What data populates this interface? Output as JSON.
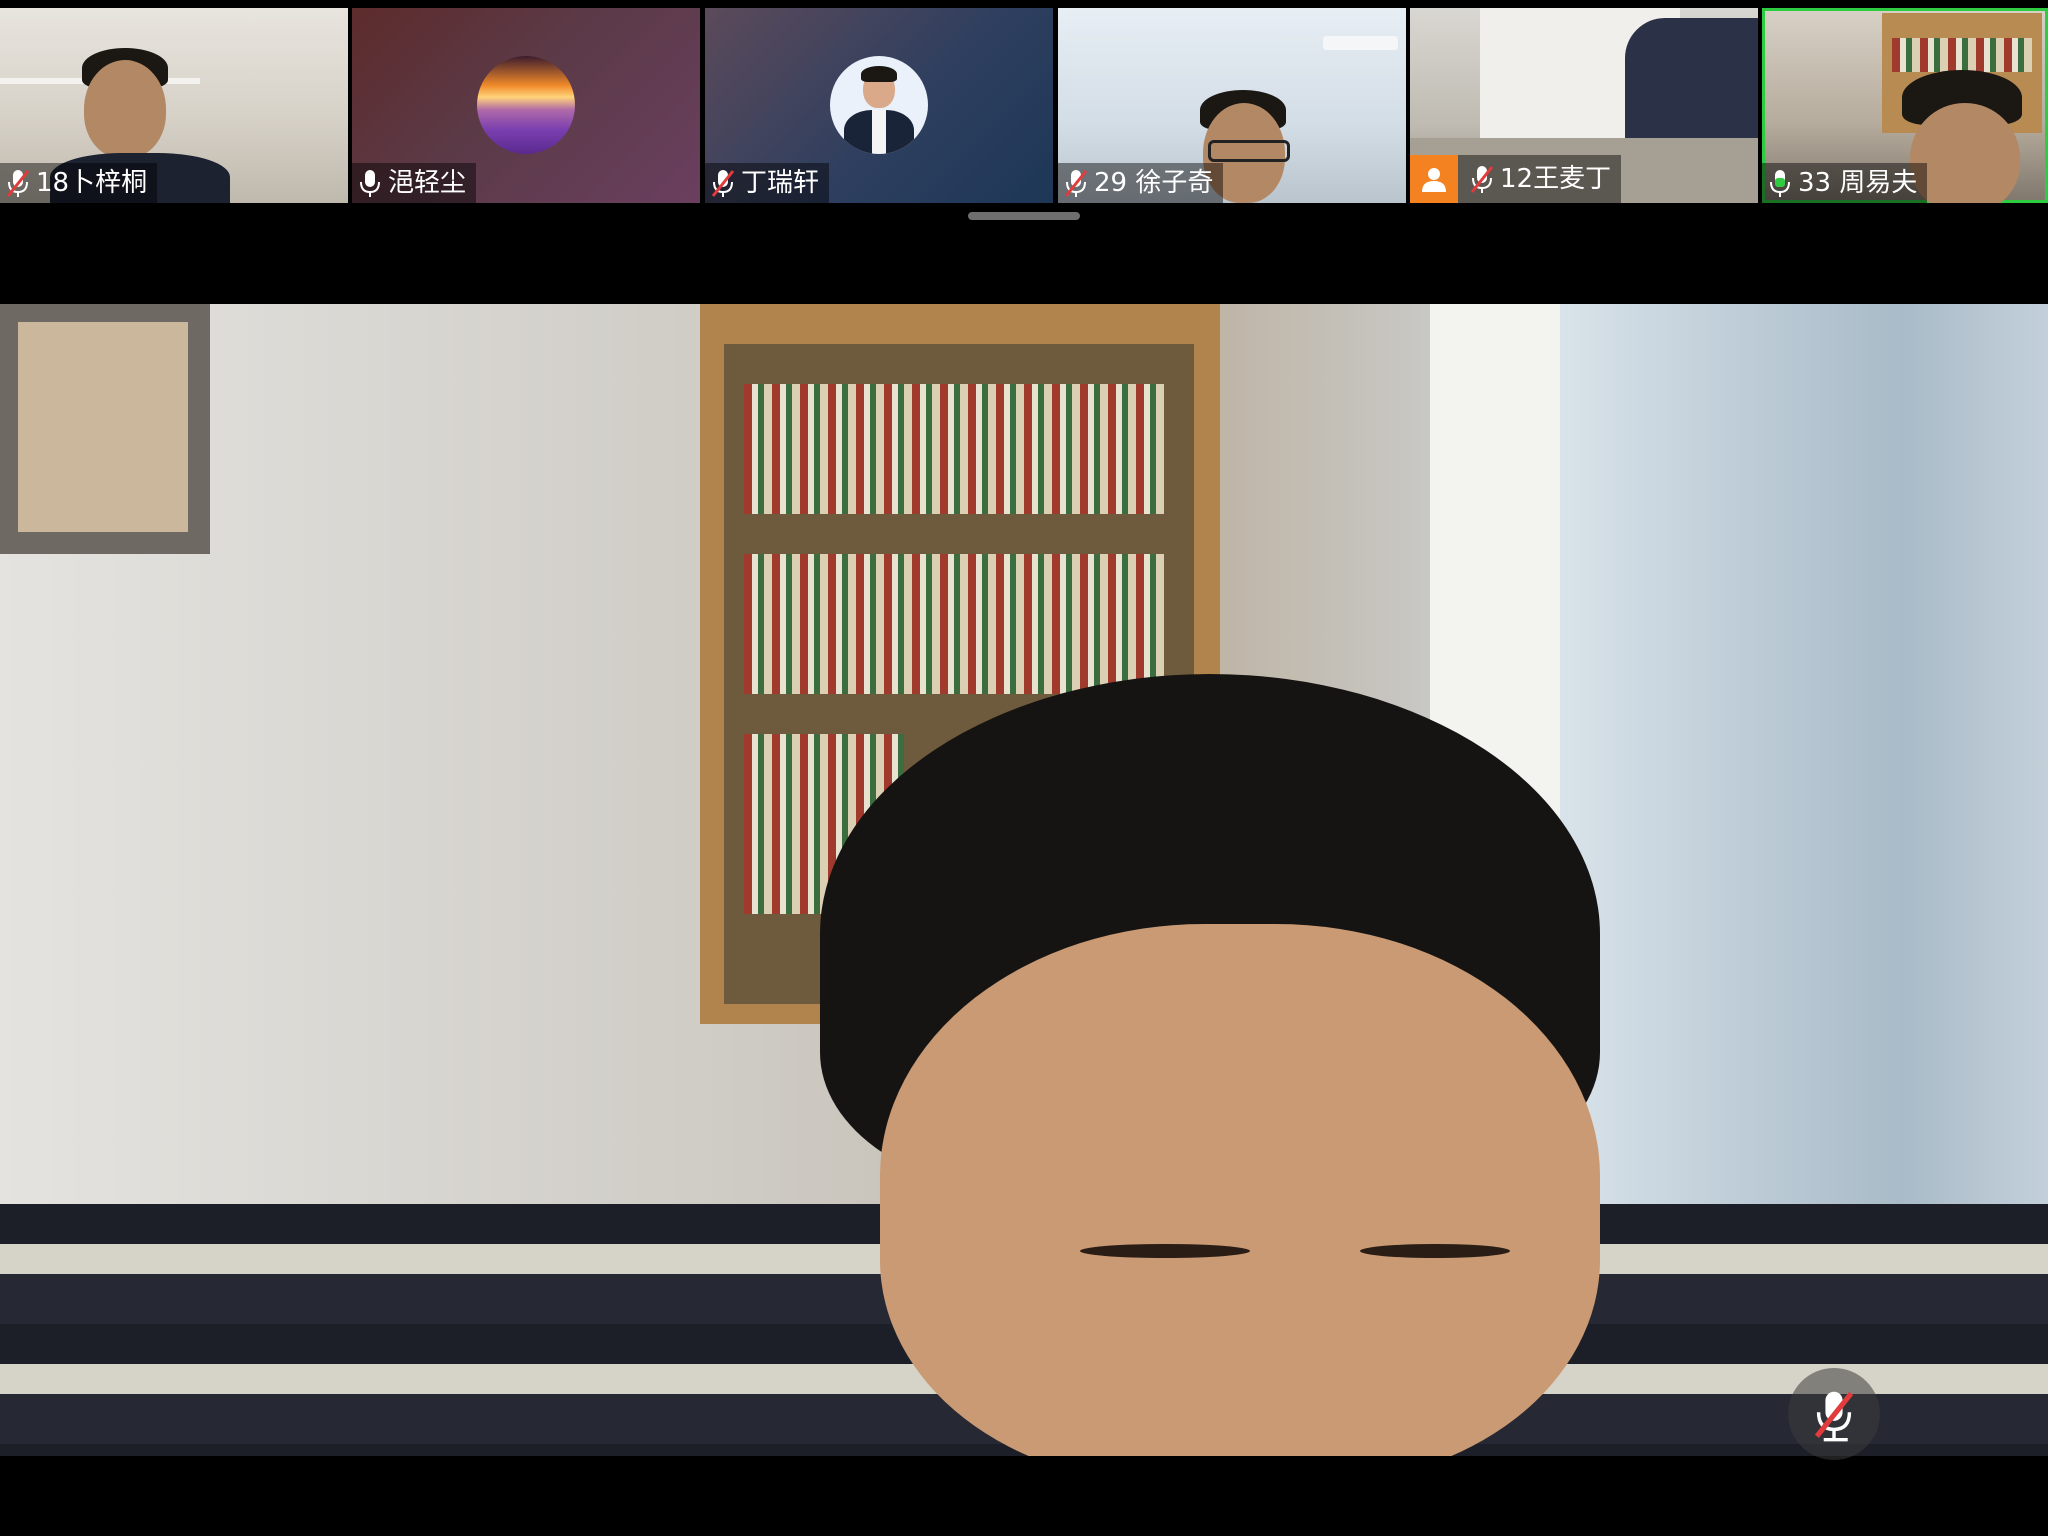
{
  "participants": [
    {
      "name": "18卜梓桐",
      "mic": "muted"
    },
    {
      "name": "浥轻尘",
      "mic": "on"
    },
    {
      "name": "丁瑞轩",
      "mic": "muted"
    },
    {
      "name": "29 徐子奇",
      "mic": "muted"
    },
    {
      "name": "12王麦丁",
      "mic": "muted",
      "badge": "person-icon"
    },
    {
      "name": "33 周易夫",
      "mic": "speaking",
      "active": true
    }
  ],
  "colors": {
    "active_border": "#2ecc40",
    "badge_orange": "#f58220",
    "speaking_green": "#2ecc40",
    "muted_red": "#e23b3b"
  },
  "main_video": {
    "controls": {
      "mute_icon": "mic-muted-icon"
    }
  }
}
